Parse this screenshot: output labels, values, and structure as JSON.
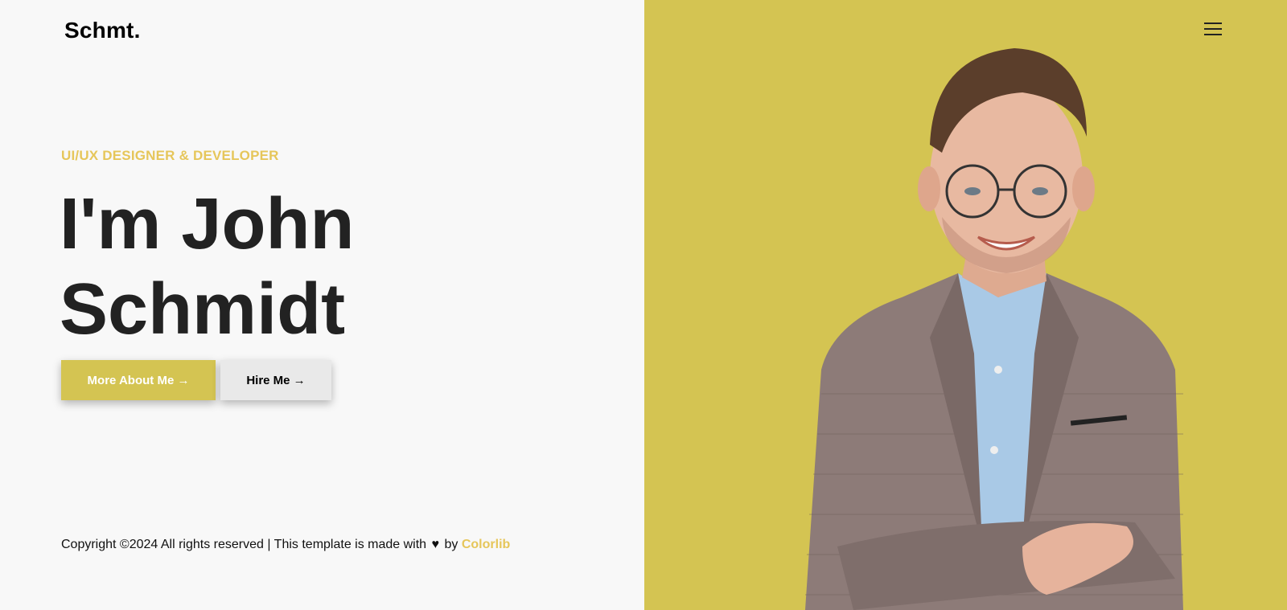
{
  "brand": {
    "logo": "Schmt."
  },
  "hero": {
    "subtitle": "UI/UX DESIGNER & DEVELOPER",
    "name_line1": "I'm John",
    "name_line2": "Schmidt",
    "primary_button": "More About Me →",
    "secondary_button": "Hire Me →"
  },
  "footer": {
    "prefix": "Copyright ©2024 All rights reserved | This template is made with",
    "heart": "♥",
    "by": "by",
    "link": "Colorlib"
  },
  "colors": {
    "accent": "#d4c452",
    "link": "#e6c65a",
    "background": "#f8f8f8"
  },
  "icons": {
    "menu": "hamburger-menu-icon"
  }
}
